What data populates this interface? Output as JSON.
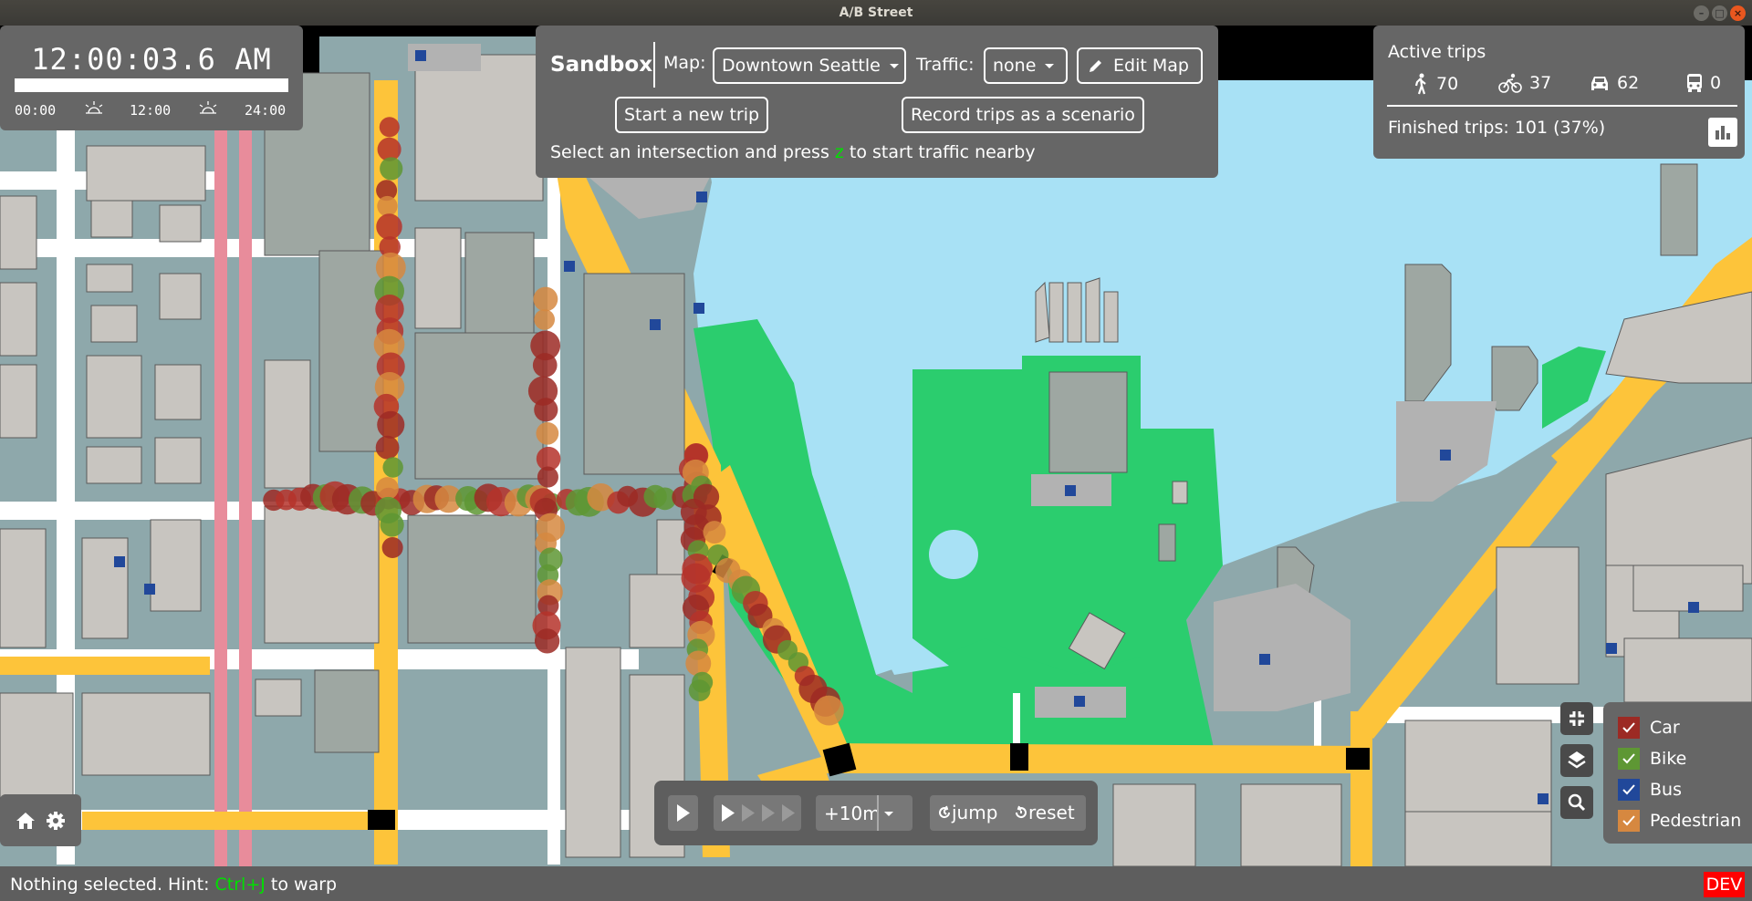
{
  "window": {
    "title": "A/B Street",
    "controls": [
      "minimize",
      "maximize",
      "close"
    ]
  },
  "clock": {
    "time": "12:00:03.6 AM",
    "day_progress": 0.0,
    "ticks": [
      "00:00",
      "12:00",
      "24:00"
    ],
    "icons": [
      "sunrise-icon",
      "sunset-icon"
    ]
  },
  "sandbox": {
    "title": "Sandbox",
    "map_label": "Map:",
    "map_value": "Downtown Seattle",
    "traffic_label": "Traffic:",
    "traffic_value": "none",
    "edit_map_label": "Edit Map",
    "start_trip_label": "Start a new trip",
    "record_label": "Record trips as a scenario",
    "hint_prefix": "Select an intersection and press ",
    "hint_key": "z",
    "hint_suffix": " to start traffic nearby"
  },
  "trips": {
    "title": "Active trips",
    "stats": [
      {
        "icon": "pedestrian-icon",
        "value": "70"
      },
      {
        "icon": "bike-icon",
        "value": "37"
      },
      {
        "icon": "car-icon",
        "value": "62"
      },
      {
        "icon": "bus-icon",
        "value": "0"
      }
    ],
    "finished": "Finished trips: 101 (37%)"
  },
  "speed": {
    "step_label": "+10m",
    "jump_label": "jump",
    "reset_label": "reset",
    "speed_level": 1,
    "speed_levels": 4
  },
  "legend": {
    "items": [
      {
        "label": "Car",
        "color": "#9c2a24",
        "checked": true
      },
      {
        "label": "Bike",
        "color": "#5e9734",
        "checked": true
      },
      {
        "label": "Bus",
        "color": "#21489a",
        "checked": true
      },
      {
        "label": "Pedestrian",
        "color": "#d68840",
        "checked": true
      }
    ]
  },
  "status": {
    "prefix": "Nothing selected. Hint: ",
    "key": "Ctrl+J",
    "suffix": " to warp",
    "dev_badge": "DEV"
  },
  "colors": {
    "panel_bg": "#666666",
    "water": "#a8e1f5",
    "park": "#2bcd6e",
    "arterial": "#fdc43a",
    "rail": "#e88c9b",
    "ground": "#8ea8ab",
    "building": "#c8c5c0",
    "building_tall": "#9ea7a2",
    "parking": "#b2b2b2"
  }
}
